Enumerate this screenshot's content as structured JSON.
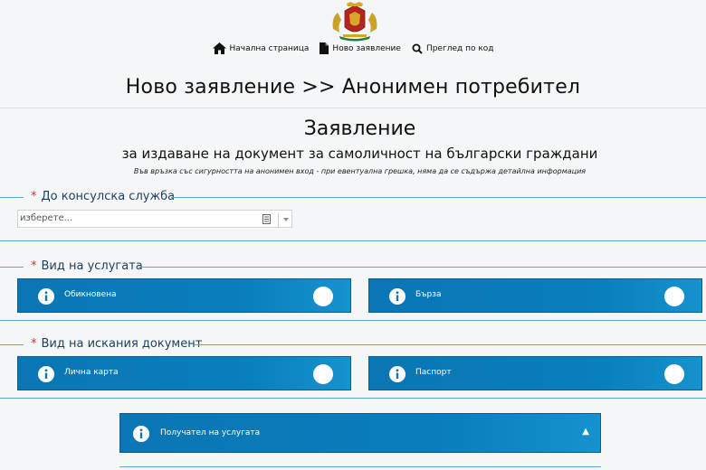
{
  "header": {
    "emblem_icon": "bulgarian-coat-of-arms",
    "nav": [
      {
        "label": "Начална страница",
        "icon": "home-icon"
      },
      {
        "label": "Ново заявление",
        "icon": "document-icon"
      },
      {
        "label": "Преглед по код",
        "icon": "search-icon"
      }
    ],
    "title": "Ново заявление >> Анонимен потребител"
  },
  "form": {
    "title": "Заявление",
    "subtitle": "за издаване на документ за самоличност на български граждани",
    "note": "Във връзка със сигурността на анонимен вход - при евентуална грешка, няма да се съдържа детайлна информация",
    "required_mark": "*",
    "consular": {
      "legend": "До консулска служба",
      "placeholder": "изберете..."
    },
    "service_type": {
      "legend": "Вид на услугата",
      "options": [
        {
          "label": "Обикновена"
        },
        {
          "label": "Бърза"
        }
      ]
    },
    "document_type": {
      "legend": "Вид на искания документ",
      "options": [
        {
          "label": "Лична карта"
        },
        {
          "label": "Паспорт"
        }
      ]
    },
    "recipient": {
      "label": "Получател на услугата",
      "arrow": "▲"
    }
  },
  "colors": {
    "accent": "#0a7fbe",
    "line": "#5fa9cf",
    "required": "#d0312d",
    "legend_text": "#1d3f5e"
  }
}
